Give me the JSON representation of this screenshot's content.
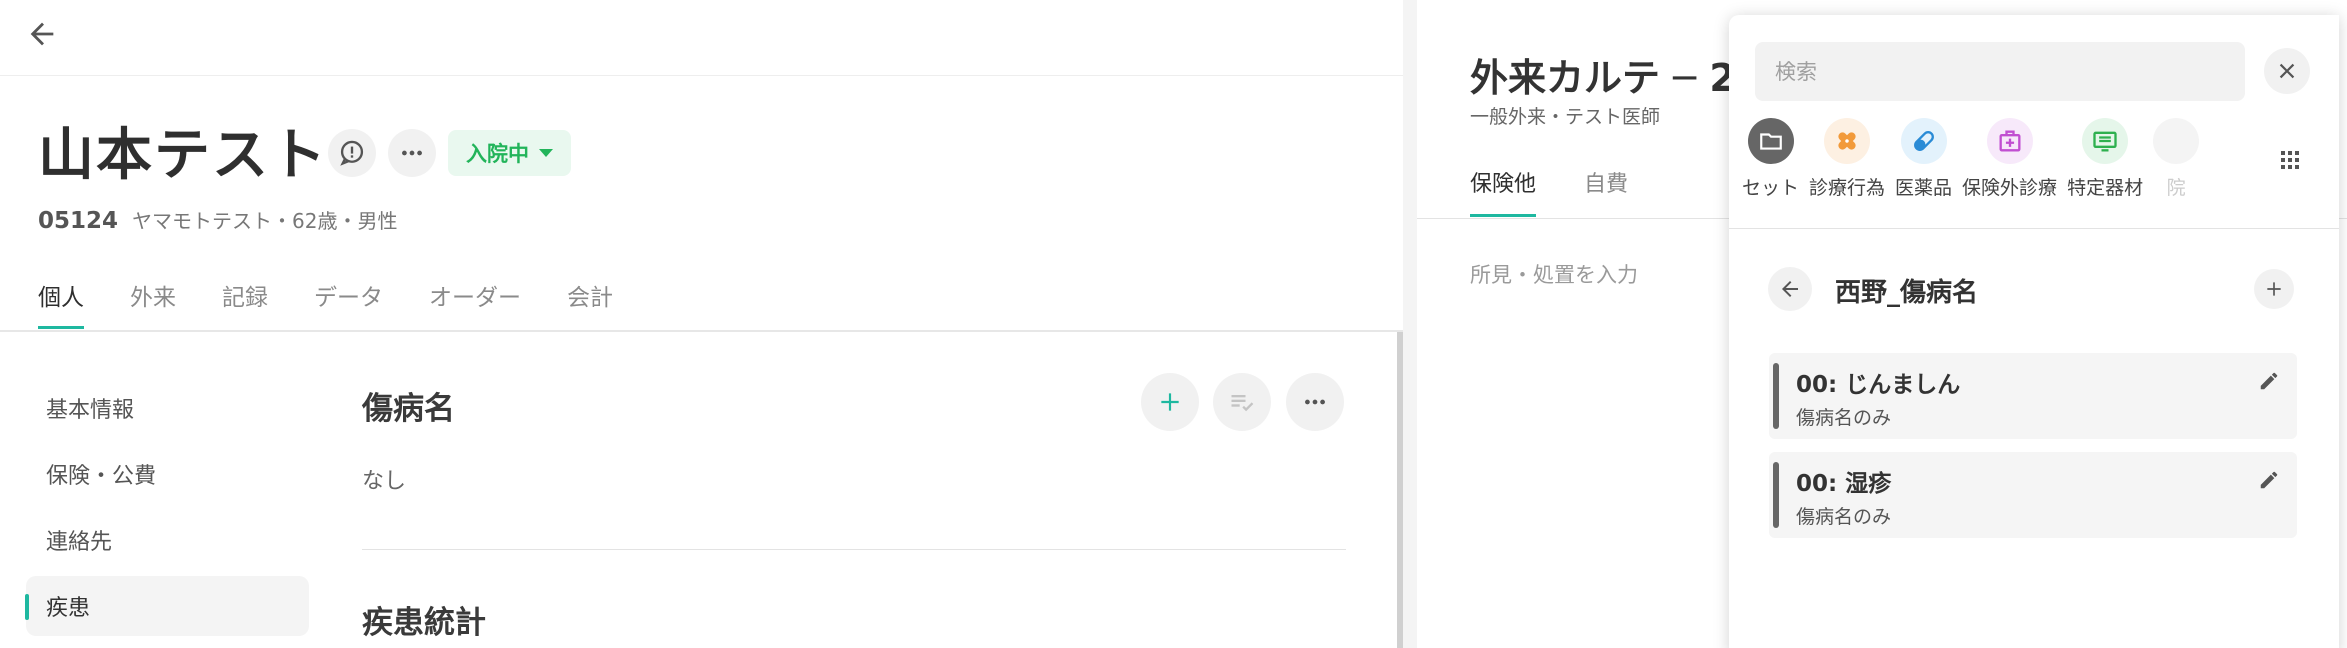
{
  "patient": {
    "name": "山本テスト",
    "id": "05124",
    "sub": "ヤマモトテスト・62歳・男性",
    "status": "入院中"
  },
  "tabs": [
    "個人",
    "外来",
    "記録",
    "データ",
    "オーダー",
    "会計"
  ],
  "side_nav": [
    "基本情報",
    "保険・公費",
    "連絡先",
    "疾患"
  ],
  "section": {
    "title": "傷病名",
    "empty_text": "なし",
    "stats_title": "疾患統計"
  },
  "chart": {
    "title": "外来カルテ ─ 2",
    "subtitle": "一般外来・テスト医師",
    "tabs": [
      "保険他",
      "自費"
    ],
    "findings_placeholder": "所見・処置を入力"
  },
  "panel": {
    "search_placeholder": "検索",
    "categories": [
      {
        "label": "セット",
        "icon": "folder-icon",
        "color": "#666666",
        "bg": "#666666"
      },
      {
        "label": "診療行為",
        "icon": "bandage-icon",
        "color": "#f29a3a",
        "bg": "#fdf0e2"
      },
      {
        "label": "医薬品",
        "icon": "pill-icon",
        "color": "#2a8bd6",
        "bg": "#e3f2fc"
      },
      {
        "label": "保険外診療",
        "icon": "medical-bag-icon",
        "color": "#c14fd1",
        "bg": "#f7e9fa"
      },
      {
        "label": "特定器材",
        "icon": "device-icon",
        "color": "#2eb04f",
        "bg": "#e5f6ea"
      },
      {
        "label": "院",
        "icon": "more-icon",
        "color": "#bbbbbb",
        "bg": "#f4f4f4"
      }
    ],
    "set_title": "西野_傷病名",
    "sets": [
      {
        "name": "00: じんましん",
        "desc": "傷病名のみ"
      },
      {
        "name": "00: 湿疹",
        "desc": "傷病名のみ"
      }
    ]
  }
}
